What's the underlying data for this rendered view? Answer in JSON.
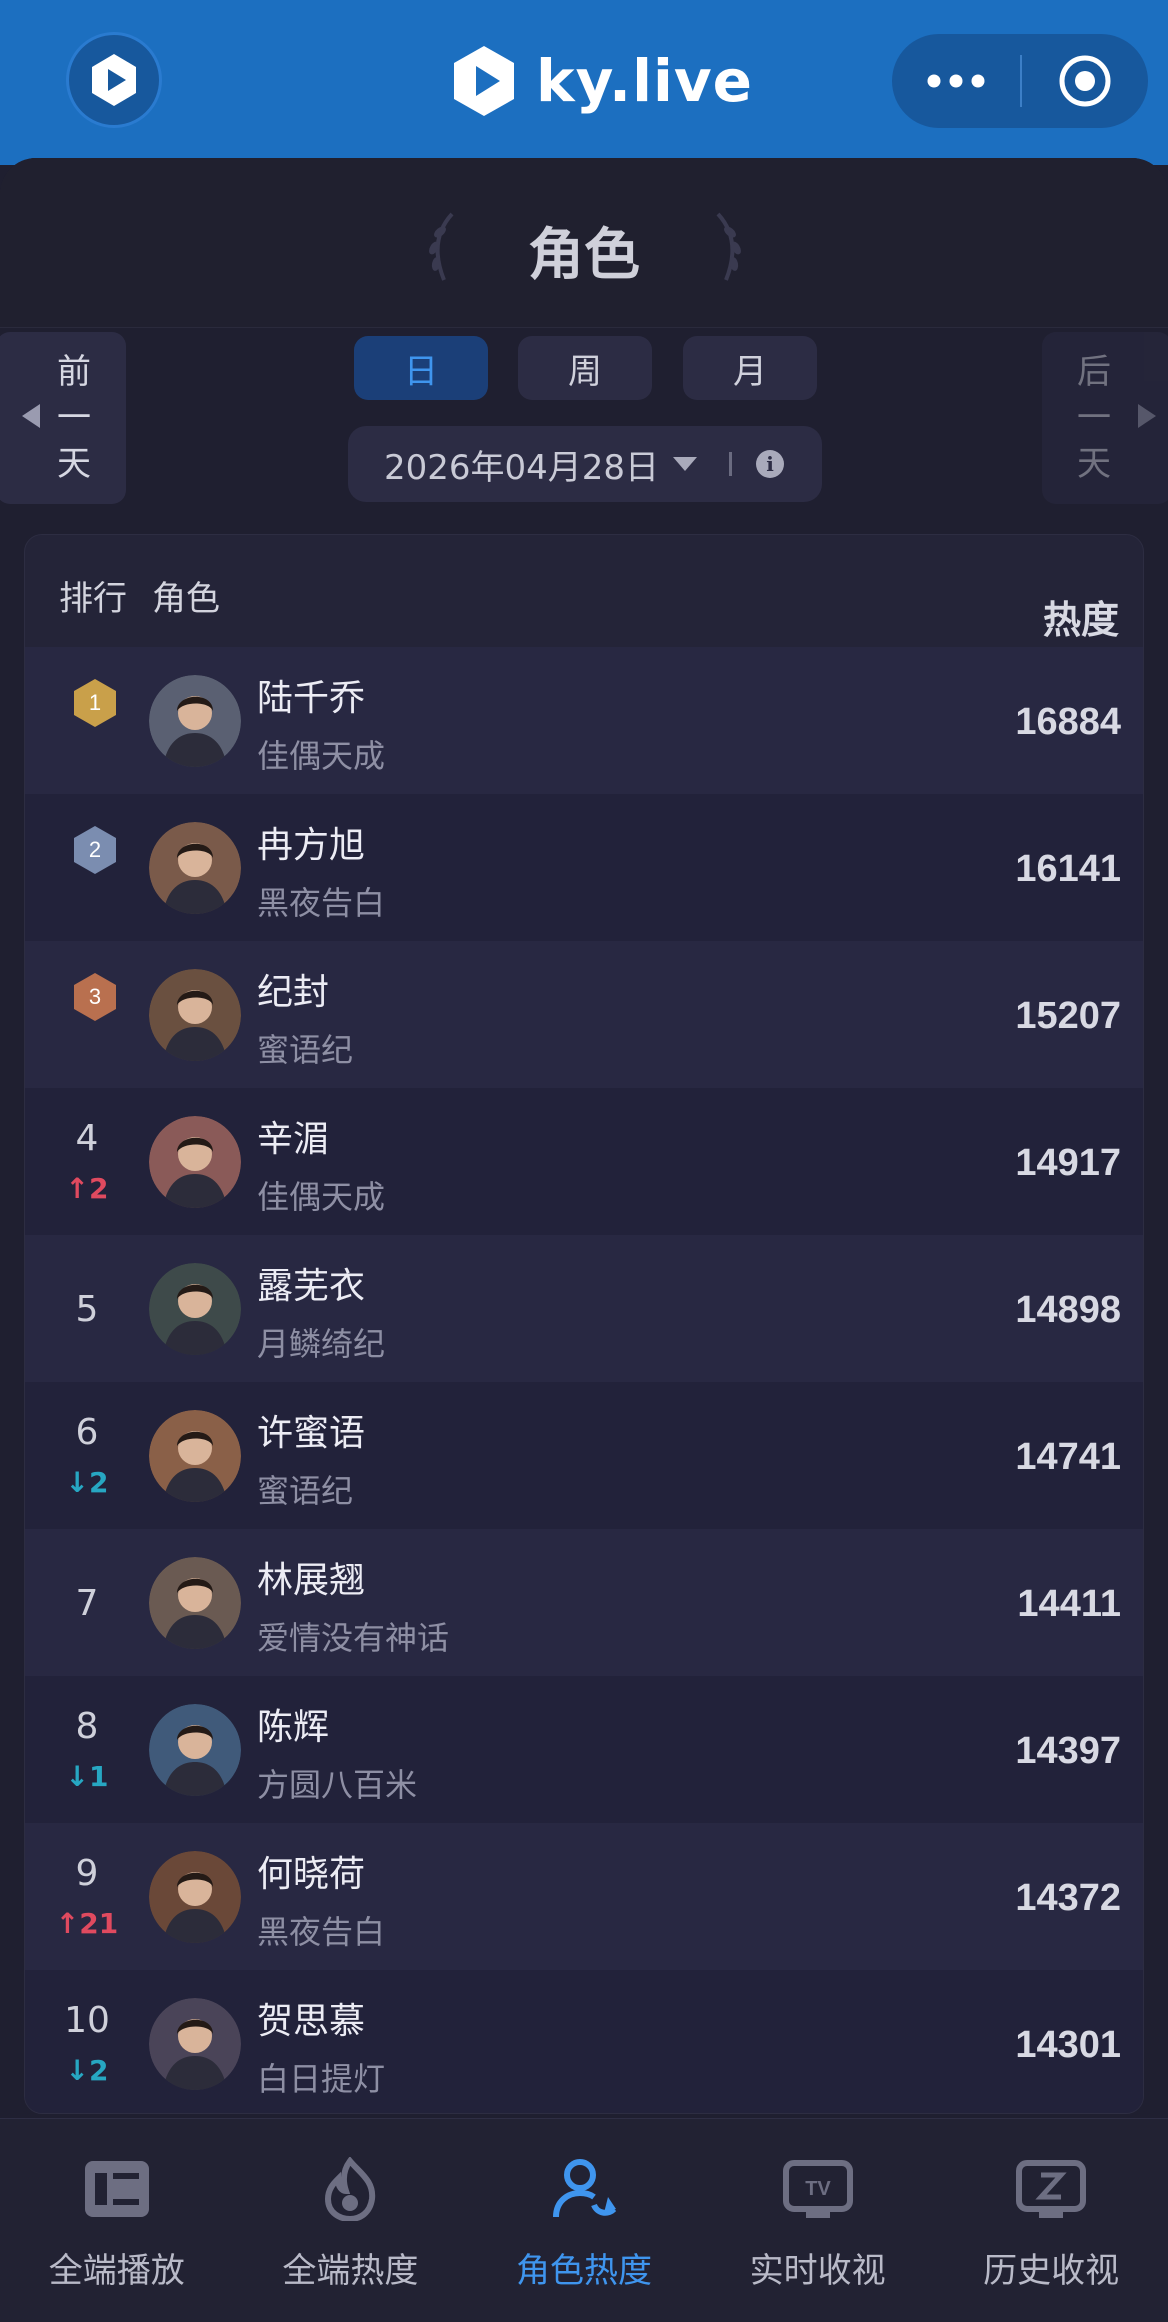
{
  "app": {
    "logo_text": "ky.live"
  },
  "page": {
    "title": "角色"
  },
  "day_nav": {
    "prev": [
      "前",
      "一",
      "天"
    ],
    "next": [
      "后",
      "一",
      "天"
    ]
  },
  "periods": [
    {
      "label": "日",
      "active": true
    },
    {
      "label": "周",
      "active": false
    },
    {
      "label": "月",
      "active": false
    }
  ],
  "date": "2026年04月28日",
  "table": {
    "headers": {
      "rank": "排行",
      "role": "角色",
      "heat": "热度"
    },
    "rows": [
      {
        "rank": "1",
        "medal": "gold",
        "change": "",
        "name": "陆千乔",
        "drama": "佳偶天成",
        "heat": "16884"
      },
      {
        "rank": "2",
        "medal": "silver",
        "change": "",
        "name": "冉方旭",
        "drama": "黑夜告白",
        "heat": "16141"
      },
      {
        "rank": "3",
        "medal": "bronze",
        "change": "",
        "name": "纪封",
        "drama": "蜜语纪",
        "heat": "15207"
      },
      {
        "rank": "4",
        "medal": "",
        "change": "2",
        "direction": "up",
        "name": "辛湄",
        "drama": "佳偶天成",
        "heat": "14917"
      },
      {
        "rank": "5",
        "medal": "",
        "change": "",
        "name": "露芜衣",
        "drama": "月鳞绮纪",
        "heat": "14898"
      },
      {
        "rank": "6",
        "medal": "",
        "change": "2",
        "direction": "down",
        "name": "许蜜语",
        "drama": "蜜语纪",
        "heat": "14741"
      },
      {
        "rank": "7",
        "medal": "",
        "change": "",
        "name": "林展翘",
        "drama": "爱情没有神话",
        "heat": "14411"
      },
      {
        "rank": "8",
        "medal": "",
        "change": "1",
        "direction": "down",
        "name": "陈辉",
        "drama": "方圆八百米",
        "heat": "14397"
      },
      {
        "rank": "9",
        "medal": "",
        "change": "21",
        "direction": "up",
        "name": "何晓荷",
        "drama": "黑夜告白",
        "heat": "14372"
      },
      {
        "rank": "10",
        "medal": "",
        "change": "2",
        "direction": "down",
        "name": "贺思慕",
        "drama": "白日提灯",
        "heat": "14301"
      }
    ]
  },
  "bottom_nav": [
    {
      "label": "全端播放",
      "icon": "play-stats-icon",
      "active": false
    },
    {
      "label": "全端热度",
      "icon": "flame-icon",
      "active": false
    },
    {
      "label": "角色热度",
      "icon": "person-refresh-icon",
      "active": true
    },
    {
      "label": "实时收视",
      "icon": "tv-icon",
      "active": false
    },
    {
      "label": "历史收视",
      "icon": "history-tv-icon",
      "active": false
    }
  ],
  "colors": {
    "accent": "#3f95ee",
    "topbar": "#1c6fc0",
    "up": "#e04a5f",
    "down": "#27a7c2",
    "gold": "#c9a04a",
    "silver": "#7b8db0",
    "bronze": "#b9704f"
  }
}
